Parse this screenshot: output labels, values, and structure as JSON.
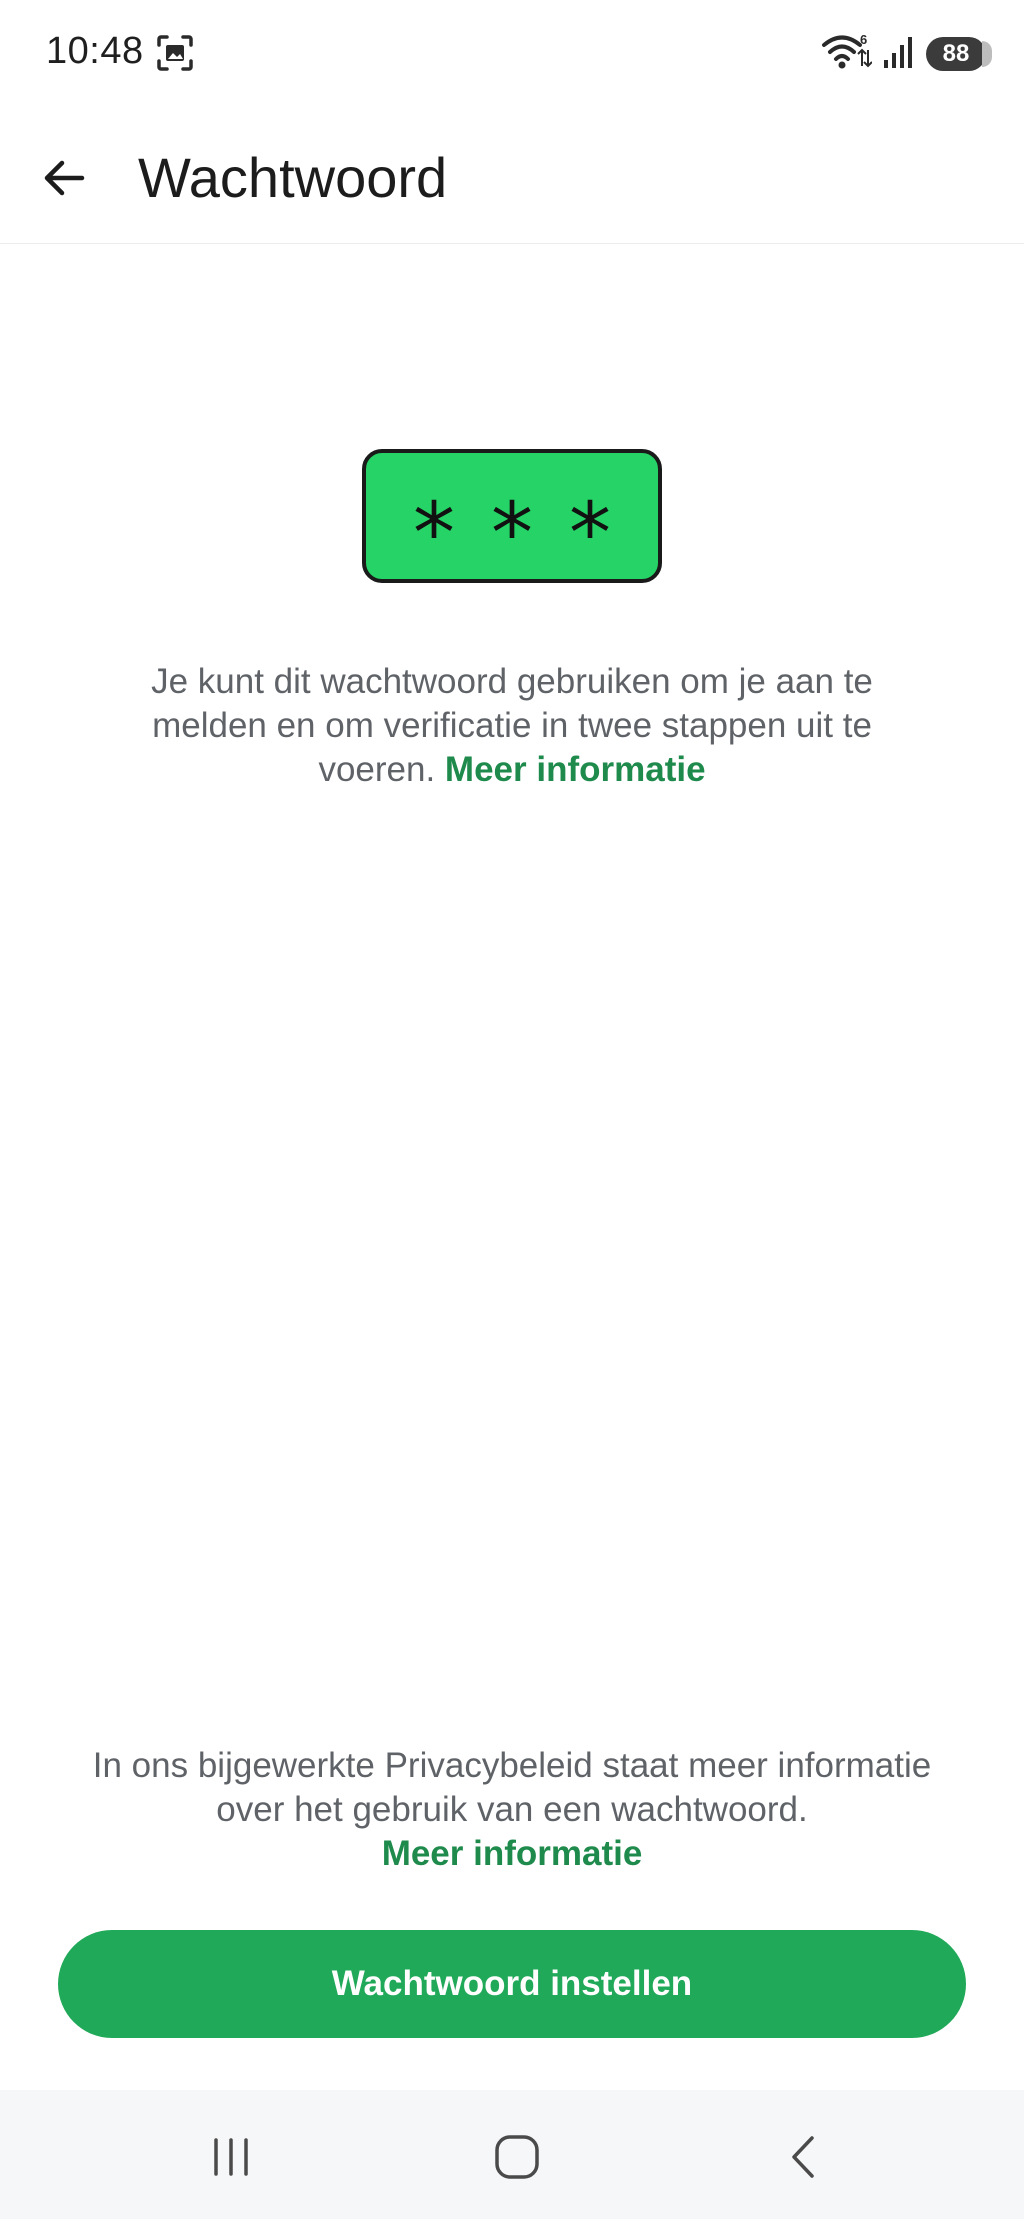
{
  "status_bar": {
    "time": "10:48",
    "battery": "88",
    "icons": [
      "screenshot-icon",
      "wifi-icon",
      "signal-icon",
      "battery-icon"
    ]
  },
  "app_bar": {
    "title": "Wachtwoord",
    "back_icon": "arrow-left-icon"
  },
  "illustration": {
    "stars": [
      "*",
      "*",
      "*"
    ],
    "color": "#25d366"
  },
  "description": {
    "text": "Je kunt dit wachtwoord gebruiken om je aan te melden en om verificatie in twee stappen uit te voeren.",
    "link": "Meer informatie"
  },
  "privacy": {
    "text": "In ons bijgewerkte Privacybeleid staat meer informatie over het gebruik van een wachtwoord.",
    "link": "Meer informatie"
  },
  "primary_button": {
    "label": "Wachtwoord instellen",
    "color": "#21a95a"
  },
  "nav_bar": {
    "icons": [
      "recents-icon",
      "home-icon",
      "back-nav-icon"
    ]
  },
  "colors": {
    "link": "#1e8a4c",
    "text_secondary": "#5f6368",
    "title": "#1c1c1c"
  }
}
